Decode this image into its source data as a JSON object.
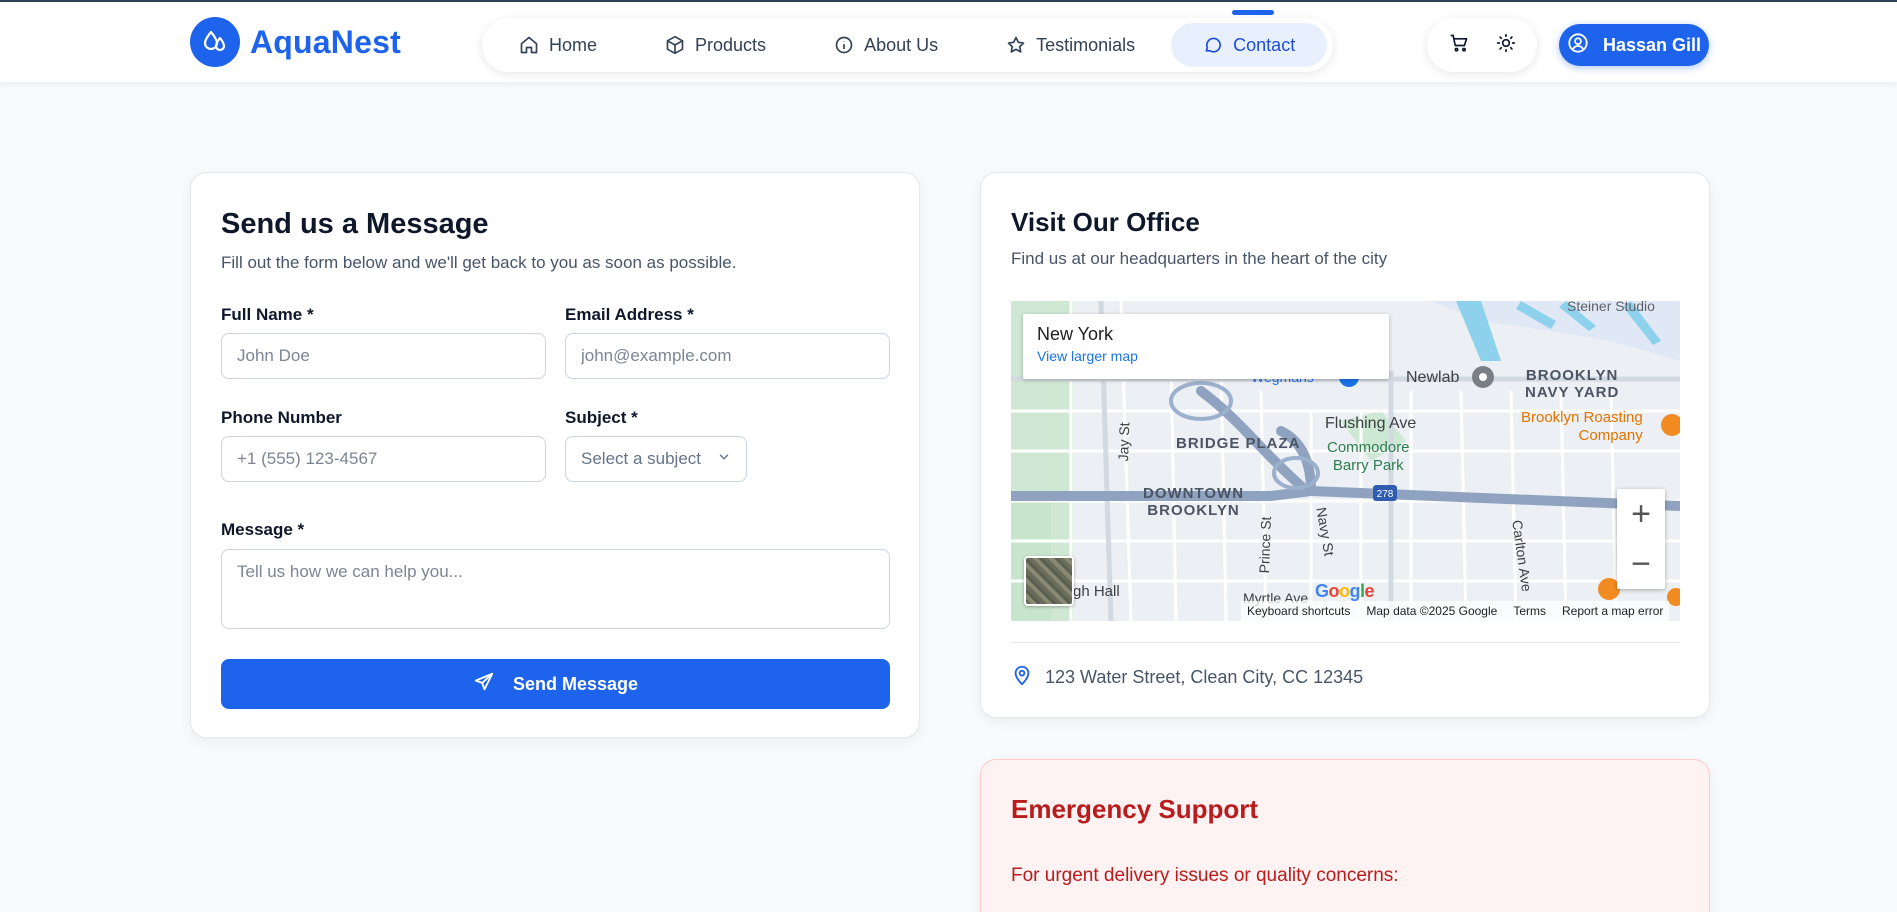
{
  "brand": {
    "name": "AquaNest",
    "color": "#1d63ec"
  },
  "nav": {
    "items": [
      {
        "label": "Home",
        "icon": "home-icon"
      },
      {
        "label": "Products",
        "icon": "box-icon"
      },
      {
        "label": "About Us",
        "icon": "info-icon"
      },
      {
        "label": "Testimonials",
        "icon": "star-icon"
      },
      {
        "label": "Contact",
        "icon": "message-icon",
        "active": true
      }
    ]
  },
  "tools": {
    "cart_icon": "cart-icon",
    "theme_icon": "sun-icon"
  },
  "user": {
    "name": "Hassan Gill",
    "icon": "user-circle-icon"
  },
  "form": {
    "title": "Send us a Message",
    "subtitle": "Fill out the form below and we'll get back to you as soon as possible.",
    "full_name": {
      "label": "Full Name *",
      "placeholder": "John Doe",
      "value": ""
    },
    "email": {
      "label": "Email Address *",
      "placeholder": "john@example.com",
      "value": ""
    },
    "phone": {
      "label": "Phone Number",
      "placeholder": "+1 (555) 123-4567",
      "value": ""
    },
    "subject": {
      "label": "Subject *",
      "selected": "Select a subject"
    },
    "message": {
      "label": "Message *",
      "placeholder": "Tell us how we can help you...",
      "value": ""
    },
    "submit_label": "Send Message"
  },
  "office": {
    "title": "Visit Our Office",
    "subtitle": "Find us at our headquarters in the heart of the city",
    "map": {
      "popup_title": "New York",
      "popup_link": "View larger map",
      "labels": {
        "steiner": "Steiner Studio",
        "newlab": "Newlab",
        "navy_yard": "BROOKLYN\nNAVY YARD",
        "roasting": "Brooklyn Roasting\nCompany",
        "flushing": "Flushing Ave",
        "bridge_plaza": "BRIDGE PLAZA",
        "commodore": "Commodore\nBarry Park",
        "downtown": "DOWNTOWN\nBROOKLYN",
        "jay": "Jay St",
        "prince": "Prince St",
        "navy_st": "Navy St",
        "carlton": "Carlton Ave",
        "myrtle": "Myrtle Ave",
        "hall": "gh Hall",
        "wegmans": "Wegmans",
        "shield": "278"
      },
      "google": "Google",
      "footer": [
        "Keyboard shortcuts",
        "Map data ©2025 Google",
        "Terms",
        "Report a map error"
      ],
      "zoom_in": "+",
      "zoom_out": "−"
    },
    "address": "123 Water Street, Clean City, CC 12345"
  },
  "emergency": {
    "title": "Emergency Support",
    "text": "For urgent delivery issues or quality concerns:"
  }
}
